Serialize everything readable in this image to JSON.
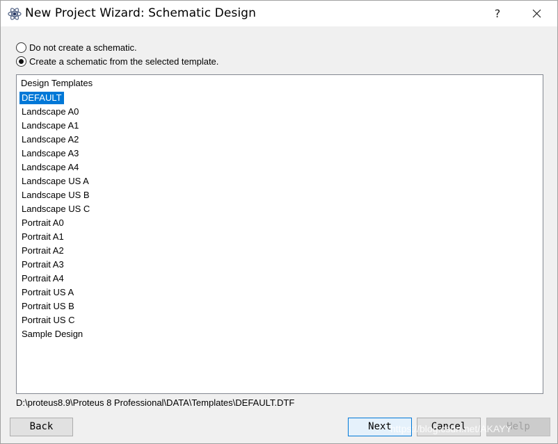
{
  "window": {
    "title": "New Project Wizard: Schematic Design",
    "help_label": "?",
    "app_icon": "proteus-atom-icon"
  },
  "options": {
    "no_schematic": {
      "label": "Do not create a schematic.",
      "checked": false
    },
    "from_template": {
      "label": "Create a schematic from the selected template.",
      "checked": true
    }
  },
  "templates": {
    "header": "Design Templates",
    "selected": "DEFAULT",
    "items": [
      "DEFAULT",
      "Landscape A0",
      "Landscape A1",
      "Landscape A2",
      "Landscape A3",
      "Landscape A4",
      "Landscape US A",
      "Landscape US B",
      "Landscape US C",
      "Portrait A0",
      "Portrait A1",
      "Portrait A2",
      "Portrait A3",
      "Portrait A4",
      "Portrait US A",
      "Portrait US B",
      "Portrait US C",
      "Sample Design"
    ]
  },
  "path": "D:\\proteus8.9\\Proteus 8 Professional\\DATA\\Templates\\DEFAULT.DTF",
  "buttons": {
    "back": "Back",
    "next": "Next",
    "cancel": "Cancel",
    "help": "Help"
  },
  "watermark": "https://blog.csdn.net/AKAYY",
  "colors": {
    "selection": "#0078d7",
    "titlebar": "#ffffff",
    "dialog_bg": "#f0f0f0"
  }
}
